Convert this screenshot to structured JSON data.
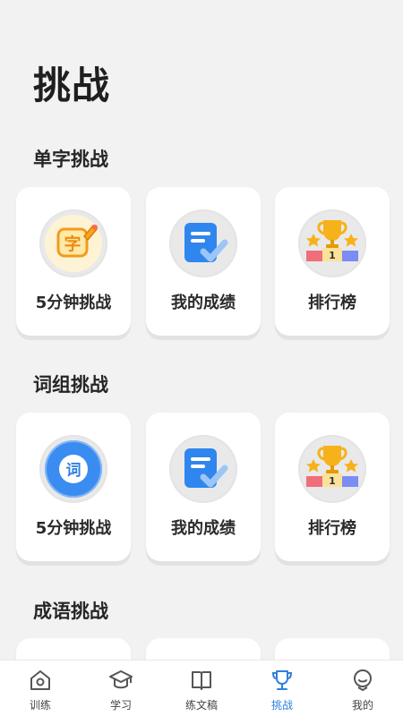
{
  "page": {
    "title": "挑战"
  },
  "sections": [
    {
      "title": "单字挑战",
      "cards": [
        {
          "label": "5分钟挑战",
          "icon": "character-char-icon",
          "glyph": "字"
        },
        {
          "label": "我的成绩",
          "icon": "score-document-icon"
        },
        {
          "label": "排行榜",
          "icon": "trophy-podium-icon",
          "rank": "1"
        }
      ]
    },
    {
      "title": "词组挑战",
      "cards": [
        {
          "label": "5分钟挑战",
          "icon": "word-badge-icon",
          "glyph": "词"
        },
        {
          "label": "我的成绩",
          "icon": "score-document-icon"
        },
        {
          "label": "排行榜",
          "icon": "trophy-podium-icon",
          "rank": "1"
        }
      ]
    },
    {
      "title": "成语挑战",
      "cards": []
    }
  ],
  "tabbar": {
    "items": [
      {
        "label": "训练",
        "icon": "home-icon",
        "active": false
      },
      {
        "label": "学习",
        "icon": "graduation-cap-icon",
        "active": false
      },
      {
        "label": "练文稿",
        "icon": "open-book-icon",
        "active": false
      },
      {
        "label": "挑战",
        "icon": "trophy-icon",
        "active": true
      },
      {
        "label": "我的",
        "icon": "profile-icon",
        "active": false
      }
    ]
  },
  "colors": {
    "accent": "#2f7fe0",
    "background": "#f2f2f2",
    "card": "#ffffff",
    "gold": "#f6b21b",
    "blue_icon": "#3b8cf0"
  }
}
